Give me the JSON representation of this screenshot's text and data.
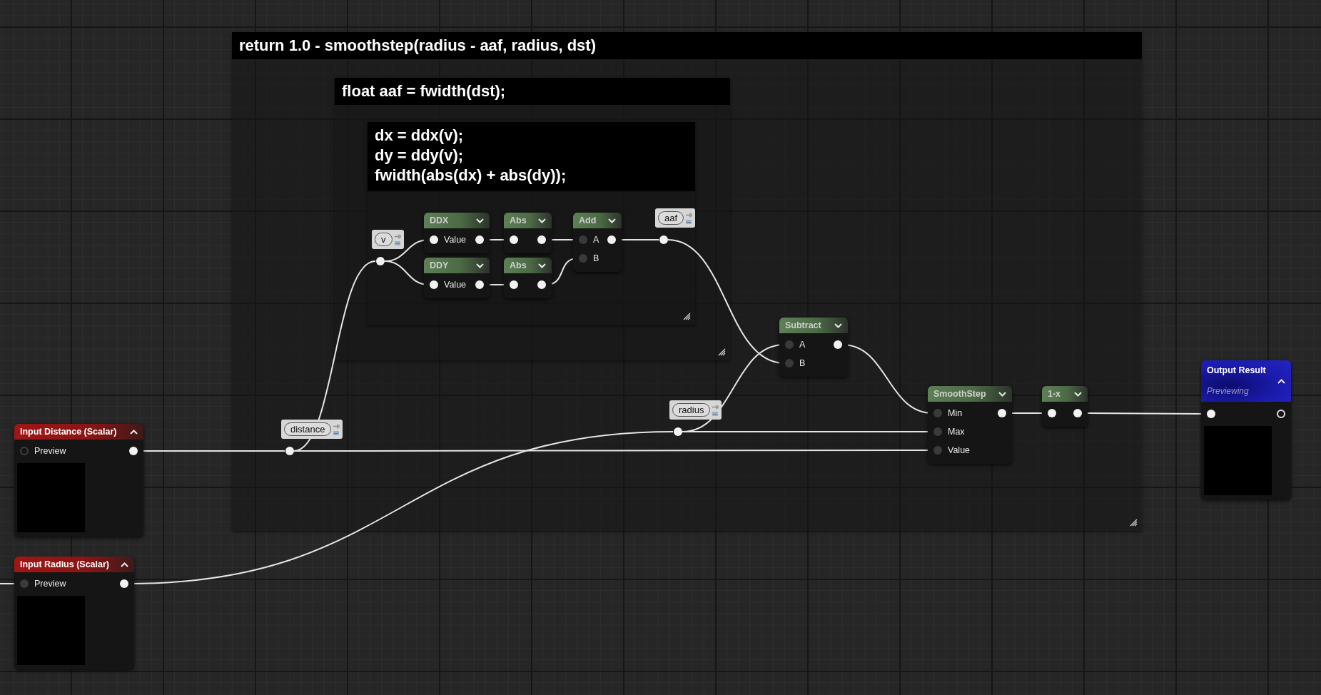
{
  "comments": [
    {
      "lines": [
        "return 1.0 - smoothstep(radius - aaf, radius, dst)"
      ]
    },
    {
      "lines": [
        "float aaf = fwidth(dst);"
      ]
    },
    {
      "lines": [
        "dx = ddx(v);",
        "dy = ddy(v);",
        "fwidth(abs(dx) + abs(dy));"
      ]
    }
  ],
  "reroutes": [
    {
      "label": "v"
    },
    {
      "label": "aaf"
    },
    {
      "label": "distance"
    },
    {
      "label": "radius"
    }
  ],
  "nodes": [
    {
      "kind": "function",
      "title": "DDX",
      "rows": [
        {
          "label": "Value",
          "in": {
            "lit": true,
            "open": false
          },
          "out": {
            "lit": true,
            "open": false
          }
        }
      ]
    },
    {
      "kind": "function",
      "title": "Abs",
      "rows": [
        {
          "in": {
            "lit": true,
            "open": false
          },
          "out": {
            "lit": true,
            "open": false
          }
        }
      ]
    },
    {
      "kind": "function",
      "title": "Add",
      "rows": [
        {
          "label": "A",
          "in": {
            "lit": false,
            "open": false
          },
          "out": {
            "lit": true,
            "open": false
          }
        },
        {
          "label": "B",
          "in": {
            "lit": false,
            "open": false
          }
        }
      ]
    },
    {
      "kind": "function",
      "title": "DDY",
      "rows": [
        {
          "label": "Value",
          "in": {
            "lit": true,
            "open": false
          },
          "out": {
            "lit": true,
            "open": false
          }
        }
      ]
    },
    {
      "kind": "function",
      "title": "Abs",
      "rows": [
        {
          "in": {
            "lit": true,
            "open": false
          },
          "out": {
            "lit": true,
            "open": false
          }
        }
      ]
    },
    {
      "kind": "function",
      "title": "Subtract",
      "rows": [
        {
          "label": "A",
          "in": {
            "lit": false,
            "open": false
          },
          "out": {
            "lit": true,
            "open": false
          }
        },
        {
          "label": "B",
          "in": {
            "lit": false,
            "open": false
          }
        }
      ]
    },
    {
      "kind": "input",
      "title": "Input Distance (Scalar)",
      "rows": [
        {
          "label": "Preview",
          "in": {
            "lit": false,
            "open": true
          },
          "out": {
            "lit": true,
            "open": false
          }
        }
      ],
      "preview": true
    },
    {
      "kind": "function",
      "title": "SmoothStep",
      "rows": [
        {
          "label": "Min",
          "in": {
            "lit": false,
            "open": false
          },
          "out": {
            "lit": true,
            "open": false
          }
        },
        {
          "label": "Max",
          "in": {
            "lit": false,
            "open": false
          }
        },
        {
          "label": "Value",
          "in": {
            "lit": false,
            "open": false
          }
        }
      ]
    },
    {
      "kind": "function",
      "title": "1-x",
      "rows": [
        {
          "in": {
            "lit": true,
            "open": false
          },
          "out": {
            "lit": true,
            "open": false
          }
        }
      ]
    },
    {
      "kind": "output",
      "title": "Output Result",
      "subtitle": "Previewing",
      "rows": [
        {
          "in": {
            "lit": true,
            "open": false
          },
          "out": {
            "lit": true,
            "open": true
          }
        }
      ],
      "preview": true
    },
    {
      "kind": "input",
      "title": "Input Radius (Scalar)",
      "rows": [
        {
          "label": "Preview",
          "in": {
            "lit": false,
            "open": false
          },
          "out": {
            "lit": true,
            "open": false
          }
        }
      ],
      "preview": true
    }
  ]
}
